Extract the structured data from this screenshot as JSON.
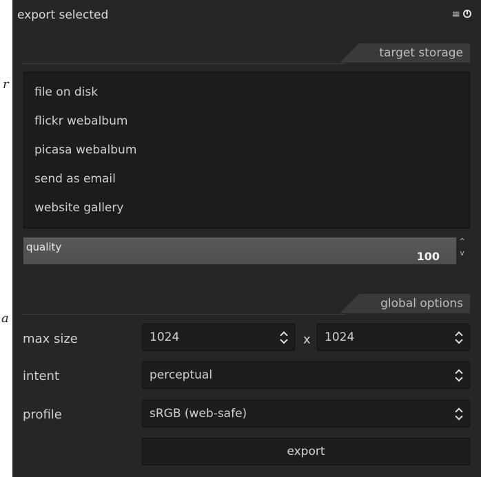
{
  "margin_glyphs": {
    "top": "r",
    "bottom": "a"
  },
  "header": {
    "title": "export selected",
    "menu_icon": "≡",
    "power_icon": "power-icon"
  },
  "target_storage": {
    "label": "target storage",
    "options": [
      "file on disk",
      "flickr webalbum",
      "picasa webalbum",
      "send as email",
      "website gallery"
    ]
  },
  "quality": {
    "label": "quality",
    "value": "100",
    "up_arrow": "^",
    "down_arrow": "v"
  },
  "global_options": {
    "label": "global options",
    "max_size": {
      "label": "max size",
      "width": "1024",
      "separator": "x",
      "height": "1024"
    },
    "intent": {
      "label": "intent",
      "value": "perceptual"
    },
    "profile": {
      "label": "profile",
      "value": "sRGB (web-safe)"
    }
  },
  "export_button": {
    "label": "export"
  },
  "colors": {
    "panel_bg": "#262626",
    "field_bg": "#1d1d1d",
    "quality_bg": "#555555"
  }
}
